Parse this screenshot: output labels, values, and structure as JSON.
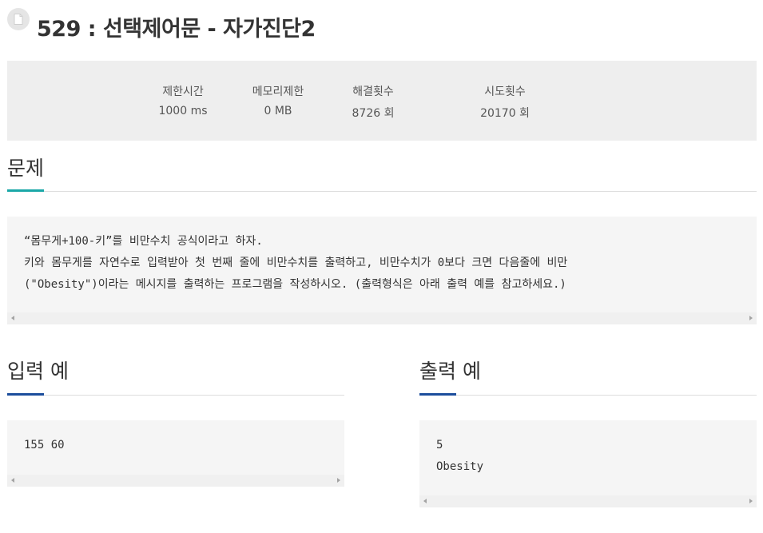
{
  "header": {
    "title": "529 : 선택제어문 - 자가진단2",
    "icon": "document-icon"
  },
  "stats": [
    {
      "label": "제한시간",
      "value": "1000 ms"
    },
    {
      "label": "메모리제한",
      "value": "0 MB"
    },
    {
      "label": "해결횟수",
      "value": "8726 회"
    },
    {
      "label": "시도횟수",
      "value": "20170 회"
    }
  ],
  "problem": {
    "heading": "문제",
    "lines": [
      "“몸무게+100-키”를 비만수치 공식이라고 하자.",
      "키와 몸무게를 자연수로 입력받아 첫 번째 줄에 비만수치를 출력하고, 비만수치가 0보다 크면 다음줄에 비만",
      "(\"Obesity\")이라는 메시지를 출력하는 프로그램을 작성하시오. (출력형식은 아래 출력 예를 참고하세요.)"
    ]
  },
  "input_example": {
    "heading": "입력 예",
    "text": "155 60"
  },
  "output_example": {
    "heading": "출력 예",
    "text": "5\nObesity"
  },
  "colors": {
    "problem_accent": "#1aa7a7",
    "example_accent": "#1c4d9c",
    "panel_bg": "#eeeeee",
    "code_bg": "#f5f5f5"
  }
}
